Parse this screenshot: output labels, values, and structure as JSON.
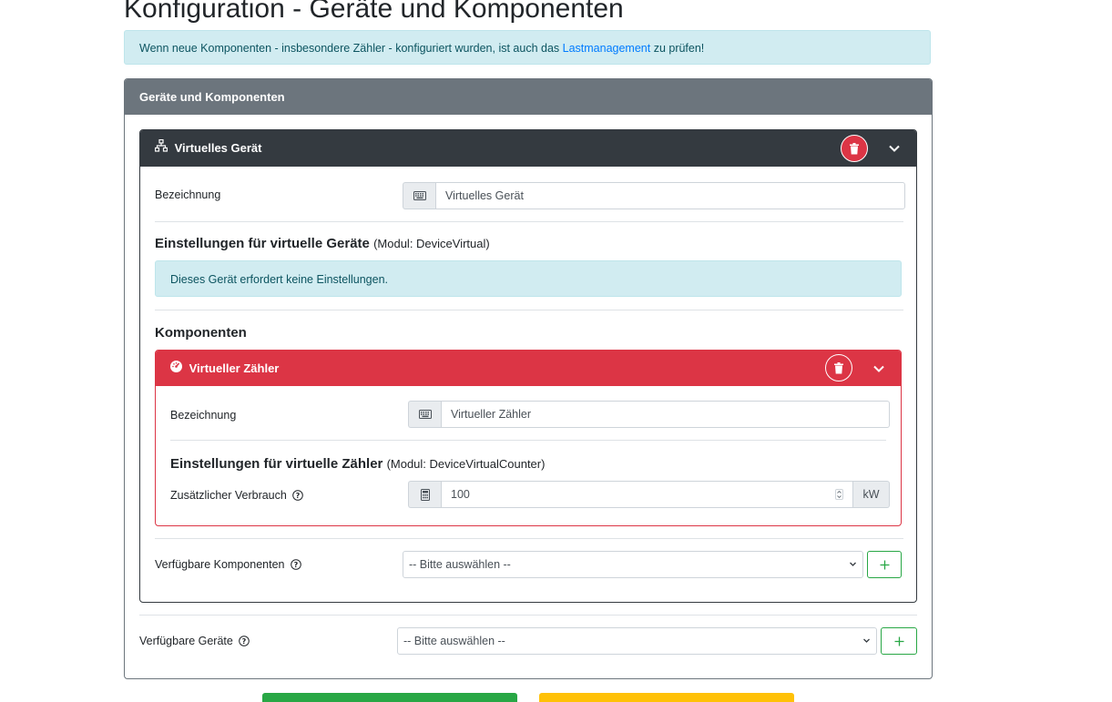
{
  "page": {
    "title": "Konfiguration - Geräte und Komponenten",
    "alert_text_before": "Wenn neue Komponenten - insbesondere Zähler - konfiguriert wurden, ist auch das ",
    "alert_link": "Lastmanagement",
    "alert_text_after": " zu prüfen!"
  },
  "main_card": {
    "title": "Geräte und Komponenten"
  },
  "device": {
    "title": "Virtuelles Gerät",
    "icon": "network-icon",
    "name_label": "Bezeichnung",
    "name_value": "Virtuelles Gerät",
    "settings_title": "Einstellungen für virtuelle Geräte",
    "settings_module": "(Modul: DeviceVirtual)",
    "settings_info": "Dieses Gerät erfordert keine Einstellungen.",
    "components_title": "Komponenten",
    "available_components_label": "Verfügbare Komponenten",
    "available_components_select": "-- Bitte auswählen --"
  },
  "component": {
    "title": "Virtueller Zähler",
    "icon": "gauge-icon",
    "name_label": "Bezeichnung",
    "name_value": "Virtueller Zähler",
    "settings_title": "Einstellungen für virtuelle Zähler",
    "settings_module": "(Modul: DeviceVirtualCounter)",
    "extra_label": "Zusätzlicher Verbrauch",
    "extra_value": "100",
    "extra_unit": "kW"
  },
  "available_devices": {
    "label": "Verfügbare Geräte",
    "select": "-- Bitte auswählen --"
  },
  "colors": {
    "danger": "#dc3545",
    "dark": "#343a40",
    "secondary": "#6c757d",
    "success": "#28a745",
    "warning": "#ffc107",
    "info_bg": "#d1ecf1"
  }
}
